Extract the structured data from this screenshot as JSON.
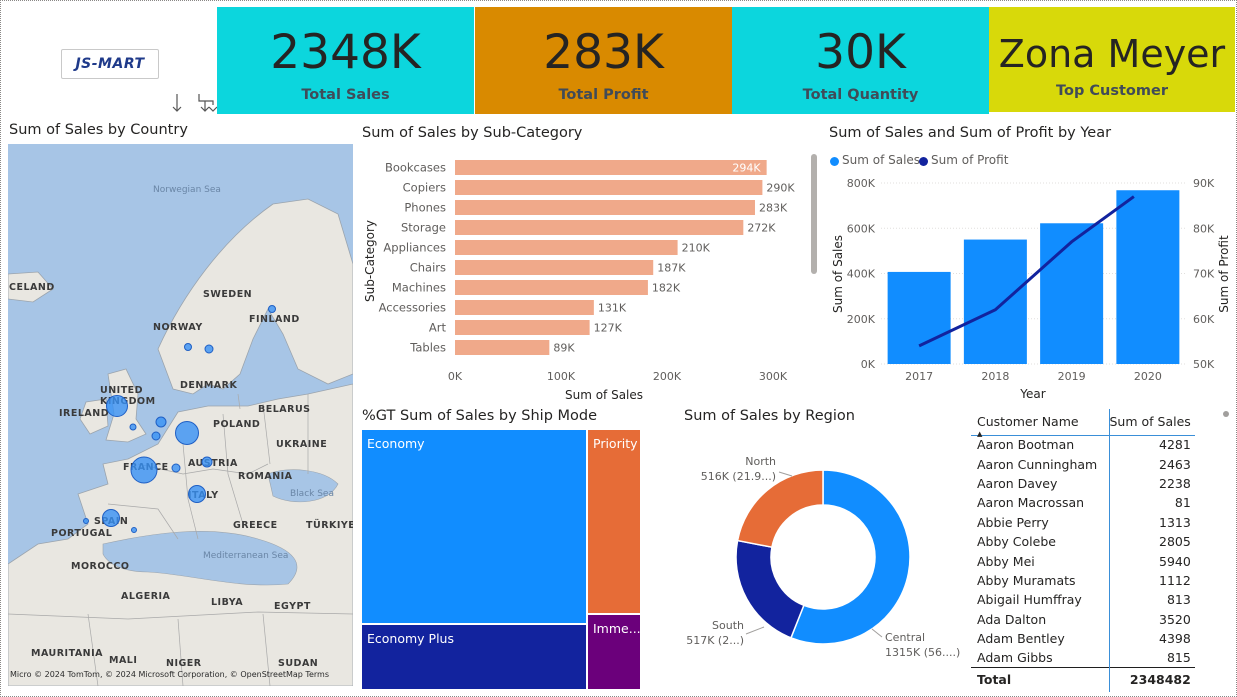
{
  "logo": {
    "text": "JS-MART"
  },
  "kpis": {
    "sales": {
      "value": "2348K",
      "label": "Total Sales",
      "color": "#0cd6dd"
    },
    "profit": {
      "value": "283K",
      "label": "Total Profit",
      "color": "#d98a00"
    },
    "quantity": {
      "value": "30K",
      "label": "Total Quantity",
      "color": "#0cd6dd"
    },
    "customer": {
      "value": "Zona Meyer",
      "label": "Top Customer",
      "color": "#d8d90a"
    }
  },
  "map": {
    "title": "Sum of Sales by Country",
    "labels": [
      "NORWAY",
      "SWEDEN",
      "FINLAND",
      "UNITED KINGDOM",
      "DENMARK",
      "IRELAND",
      "POLAND",
      "BELARUS",
      "UKRAINE",
      "FRANCE",
      "AUSTRIA",
      "ROMANIA",
      "ITALY",
      "SPAIN",
      "PORTUGAL",
      "GREECE",
      "TÜRKIYE",
      "MOROCCO",
      "ALGERIA",
      "LIBYA",
      "EGYPT",
      "MAURITANIA",
      "MALI",
      "NIGER",
      "SUDAN",
      "CELAND"
    ],
    "seas": [
      "Norwegian Sea",
      "Black Sea",
      "Mediterranean Sea"
    ],
    "attribution": "© 2024 TomTom, © 2024 Microsoft Corporation, © OpenStreetMap  Terms",
    "ms_mark": "Micro"
  },
  "subcat_chart": {
    "title": "Sum of Sales by Sub-Category",
    "chart_data": {
      "type": "bar",
      "categories": [
        "Bookcases",
        "Copiers",
        "Phones",
        "Storage",
        "Appliances",
        "Chairs",
        "Machines",
        "Accessories",
        "Art",
        "Tables"
      ],
      "values": [
        294,
        290,
        283,
        272,
        210,
        187,
        182,
        131,
        127,
        89
      ],
      "value_labels": [
        "294K",
        "290K",
        "283K",
        "272K",
        "210K",
        "187K",
        "182K",
        "131K",
        "127K",
        "89K"
      ],
      "xticks": [
        "0K",
        "100K",
        "200K",
        "300K"
      ],
      "xlabel": "Sum of Sales",
      "ylabel": "Sub-Category",
      "xlim": [
        0,
        300
      ],
      "color": "#f0a98a"
    }
  },
  "year_chart": {
    "title": "Sum of Sales and Sum of Profit by Year",
    "legend": [
      {
        "name": "Sum of Sales",
        "color": "#118dff"
      },
      {
        "name": "Sum of Profit",
        "color": "#12239e"
      }
    ],
    "chart_data": {
      "type": "bar",
      "categories": [
        "2017",
        "2018",
        "2019",
        "2020"
      ],
      "series": [
        {
          "name": "Sum of Sales",
          "type": "bar",
          "values": [
            407,
            550,
            622,
            768
          ]
        },
        {
          "name": "Sum of Profit",
          "type": "line",
          "values": [
            54,
            62,
            77,
            87
          ]
        }
      ],
      "y_left_ticks": [
        "0K",
        "200K",
        "400K",
        "600K",
        "800K"
      ],
      "y_right_ticks": [
        "50K",
        "60K",
        "70K",
        "80K",
        "90K"
      ],
      "ylim_left": [
        0,
        800
      ],
      "ylim_right": [
        50,
        90
      ],
      "xlabel": "Year",
      "ylabel_left": "Sum of Sales",
      "ylabel_right": "Sum of Profit"
    }
  },
  "ship_chart": {
    "title": "%GT Sum of Sales by Ship Mode",
    "cells": [
      {
        "label": "Economy",
        "color": "#118dff"
      },
      {
        "label": "Economy Plus",
        "color": "#12239e"
      },
      {
        "label": "Priority",
        "color": "#e66c37"
      },
      {
        "label": "Imme...",
        "color": "#6b007b"
      }
    ]
  },
  "region_chart": {
    "title": "Sum of Sales by Region",
    "chart_data": {
      "type": "pie",
      "categories": [
        "Central",
        "South",
        "North"
      ],
      "values": [
        1315,
        517,
        516
      ],
      "colors": [
        "#118dff",
        "#12239e",
        "#e66c37"
      ]
    },
    "labels": [
      {
        "name": "North",
        "value": "516K (21.9...)"
      },
      {
        "name": "South",
        "value": "517K (2...)"
      },
      {
        "name": "Central",
        "value": "1315K (56....)"
      }
    ]
  },
  "customer_table": {
    "headers": [
      "Customer Name",
      "Sum of Sales"
    ],
    "rows": [
      [
        "Aaron Bootman",
        "4281"
      ],
      [
        "Aaron Cunningham",
        "2463"
      ],
      [
        "Aaron Davey",
        "2238"
      ],
      [
        "Aaron Macrossan",
        "81"
      ],
      [
        "Abbie Perry",
        "1313"
      ],
      [
        "Abby Colebe",
        "2805"
      ],
      [
        "Abby Mei",
        "5940"
      ],
      [
        "Abby Muramats",
        "1112"
      ],
      [
        "Abigail Humffray",
        "813"
      ],
      [
        "Ada Dalton",
        "3520"
      ],
      [
        "Adam Bentley",
        "4398"
      ],
      [
        "Adam Gibbs",
        "815"
      ]
    ],
    "total": [
      "Total",
      "2348482"
    ]
  }
}
